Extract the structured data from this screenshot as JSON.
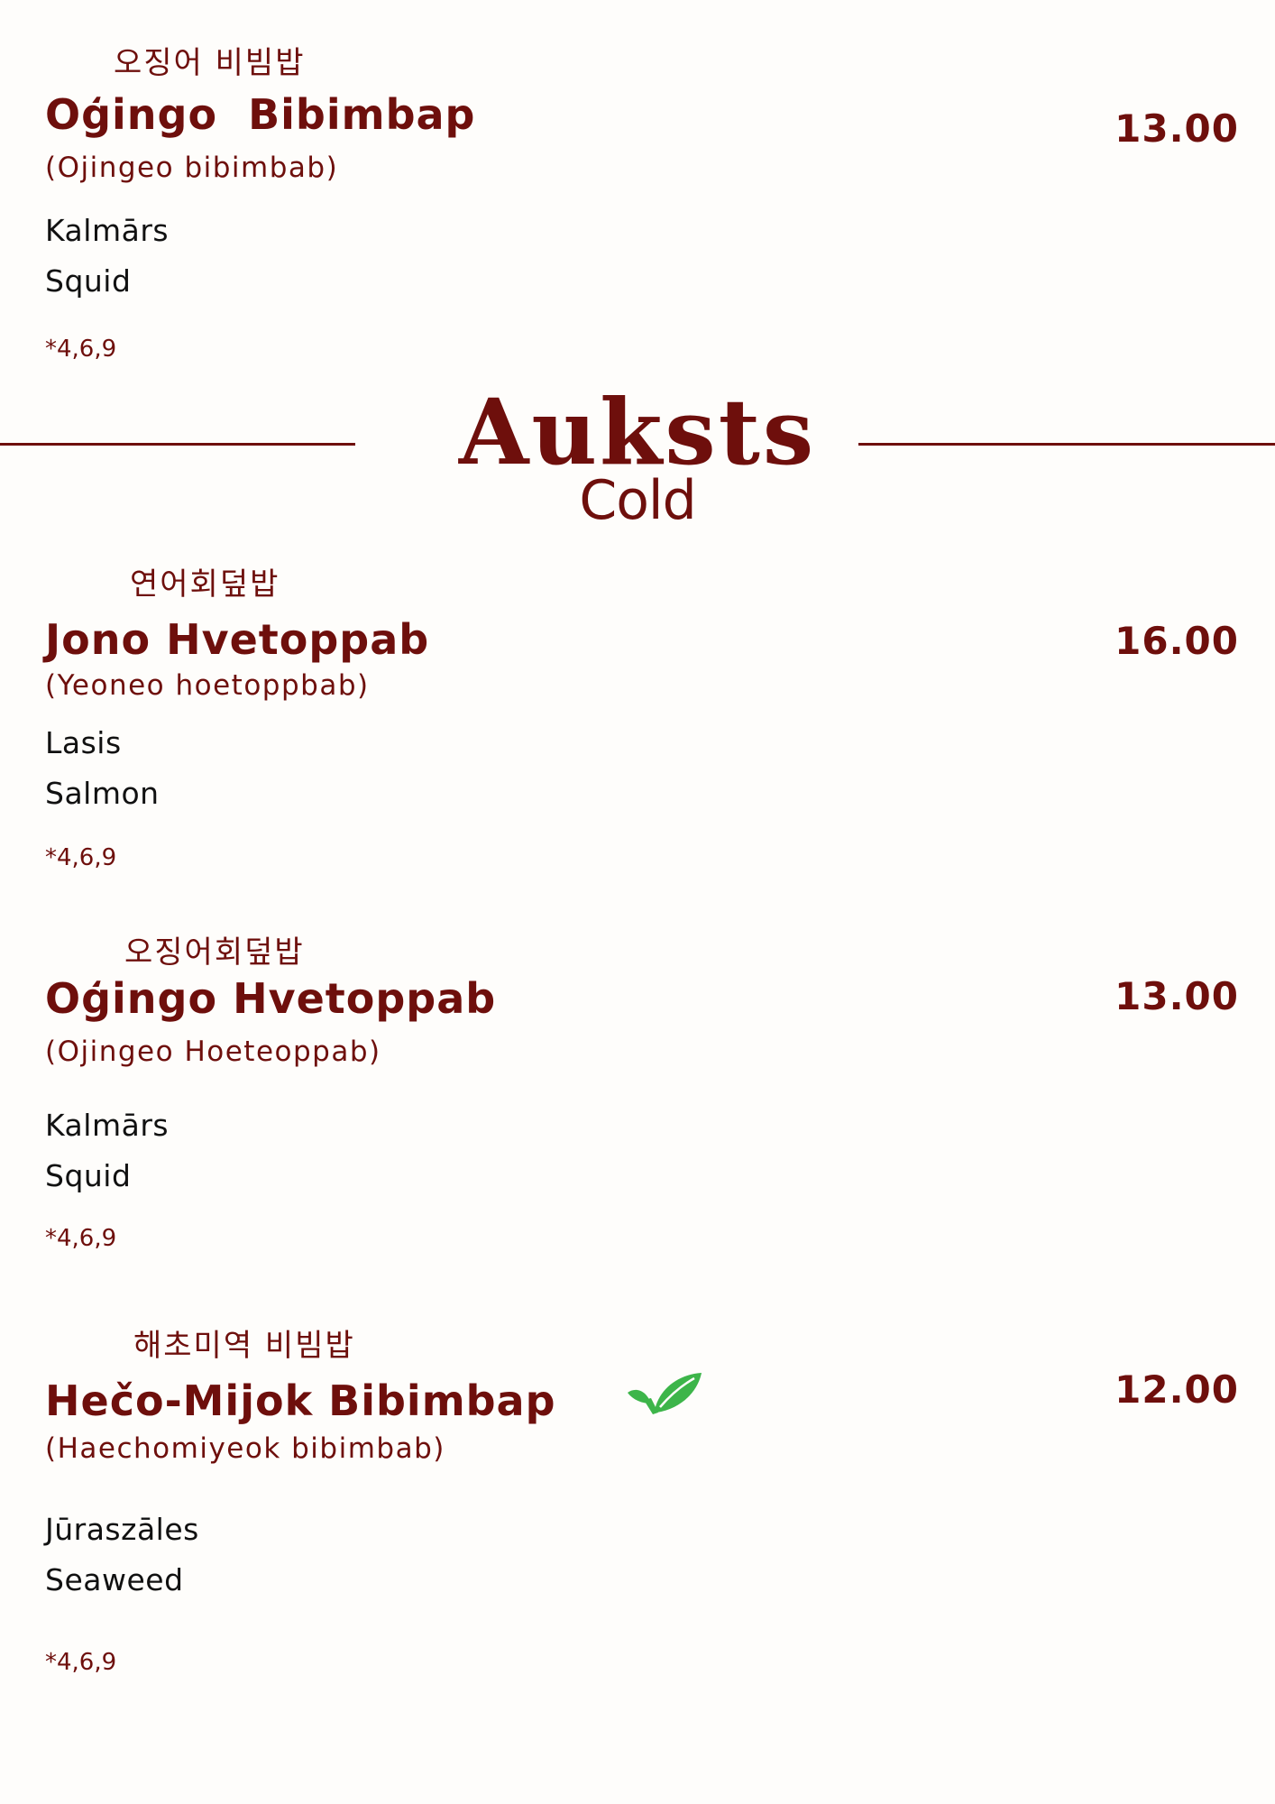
{
  "items_top": {
    "korean": "오징어 비빔밥",
    "name": "Oģingo  Bibimbap",
    "romanized": "(Ojingeo bibimbab)",
    "desc_lv": "Kalmārs",
    "desc_en": "Squid",
    "allergens": "*4,6,9",
    "price": "13.00"
  },
  "section": {
    "title": "Auksts",
    "subtitle": "Cold"
  },
  "items": [
    {
      "korean": "연어회덮밥",
      "name": "Jono Hvetoppab",
      "romanized": "(Yeoneo hoetoppbab)",
      "desc_lv": "Lasis",
      "desc_en": "Salmon",
      "allergens": "*4,6,9",
      "price": "16.00"
    },
    {
      "korean": "오징어회덮밥",
      "name": "Oģingo Hvetoppab",
      "romanized": "(Ojingeo Hoeteoppab)",
      "desc_lv": "Kalmārs",
      "desc_en": "Squid",
      "allergens": "*4,6,9",
      "price": "13.00"
    },
    {
      "korean": "해초미역 비빔밥",
      "name": "Hečo-Mijok Bibimbap",
      "romanized": "(Haechomiyeok bibimbab)",
      "desc_lv": "Jūraszāles",
      "desc_en": "Seaweed",
      "allergens": "*4,6,9",
      "price": "12.00",
      "badge_icon": "vegan-leaf-check-icon",
      "badge_color": "#3db54a"
    }
  ],
  "colors": {
    "accent": "#6e0f0c",
    "background": "#fefdfb"
  }
}
